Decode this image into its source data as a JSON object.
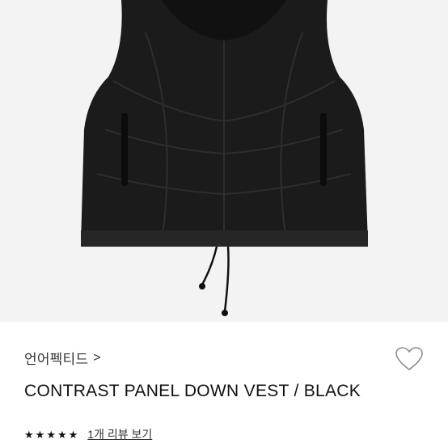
{
  "product": {
    "image_alt": "black quilted down vest",
    "brand": "언어펙티드",
    "brand_chevron": ">",
    "title": "CONTRAST PANEL DOWN VEST / BLACK",
    "wishlist_icon": "heart-outline-icon",
    "rating": 5,
    "star_glyph": "★",
    "reviews_label": "1개 리뷰 보기"
  },
  "colors": {
    "background": "#f3f3f3",
    "vest": "#1b1b1b",
    "text": "#111111"
  }
}
